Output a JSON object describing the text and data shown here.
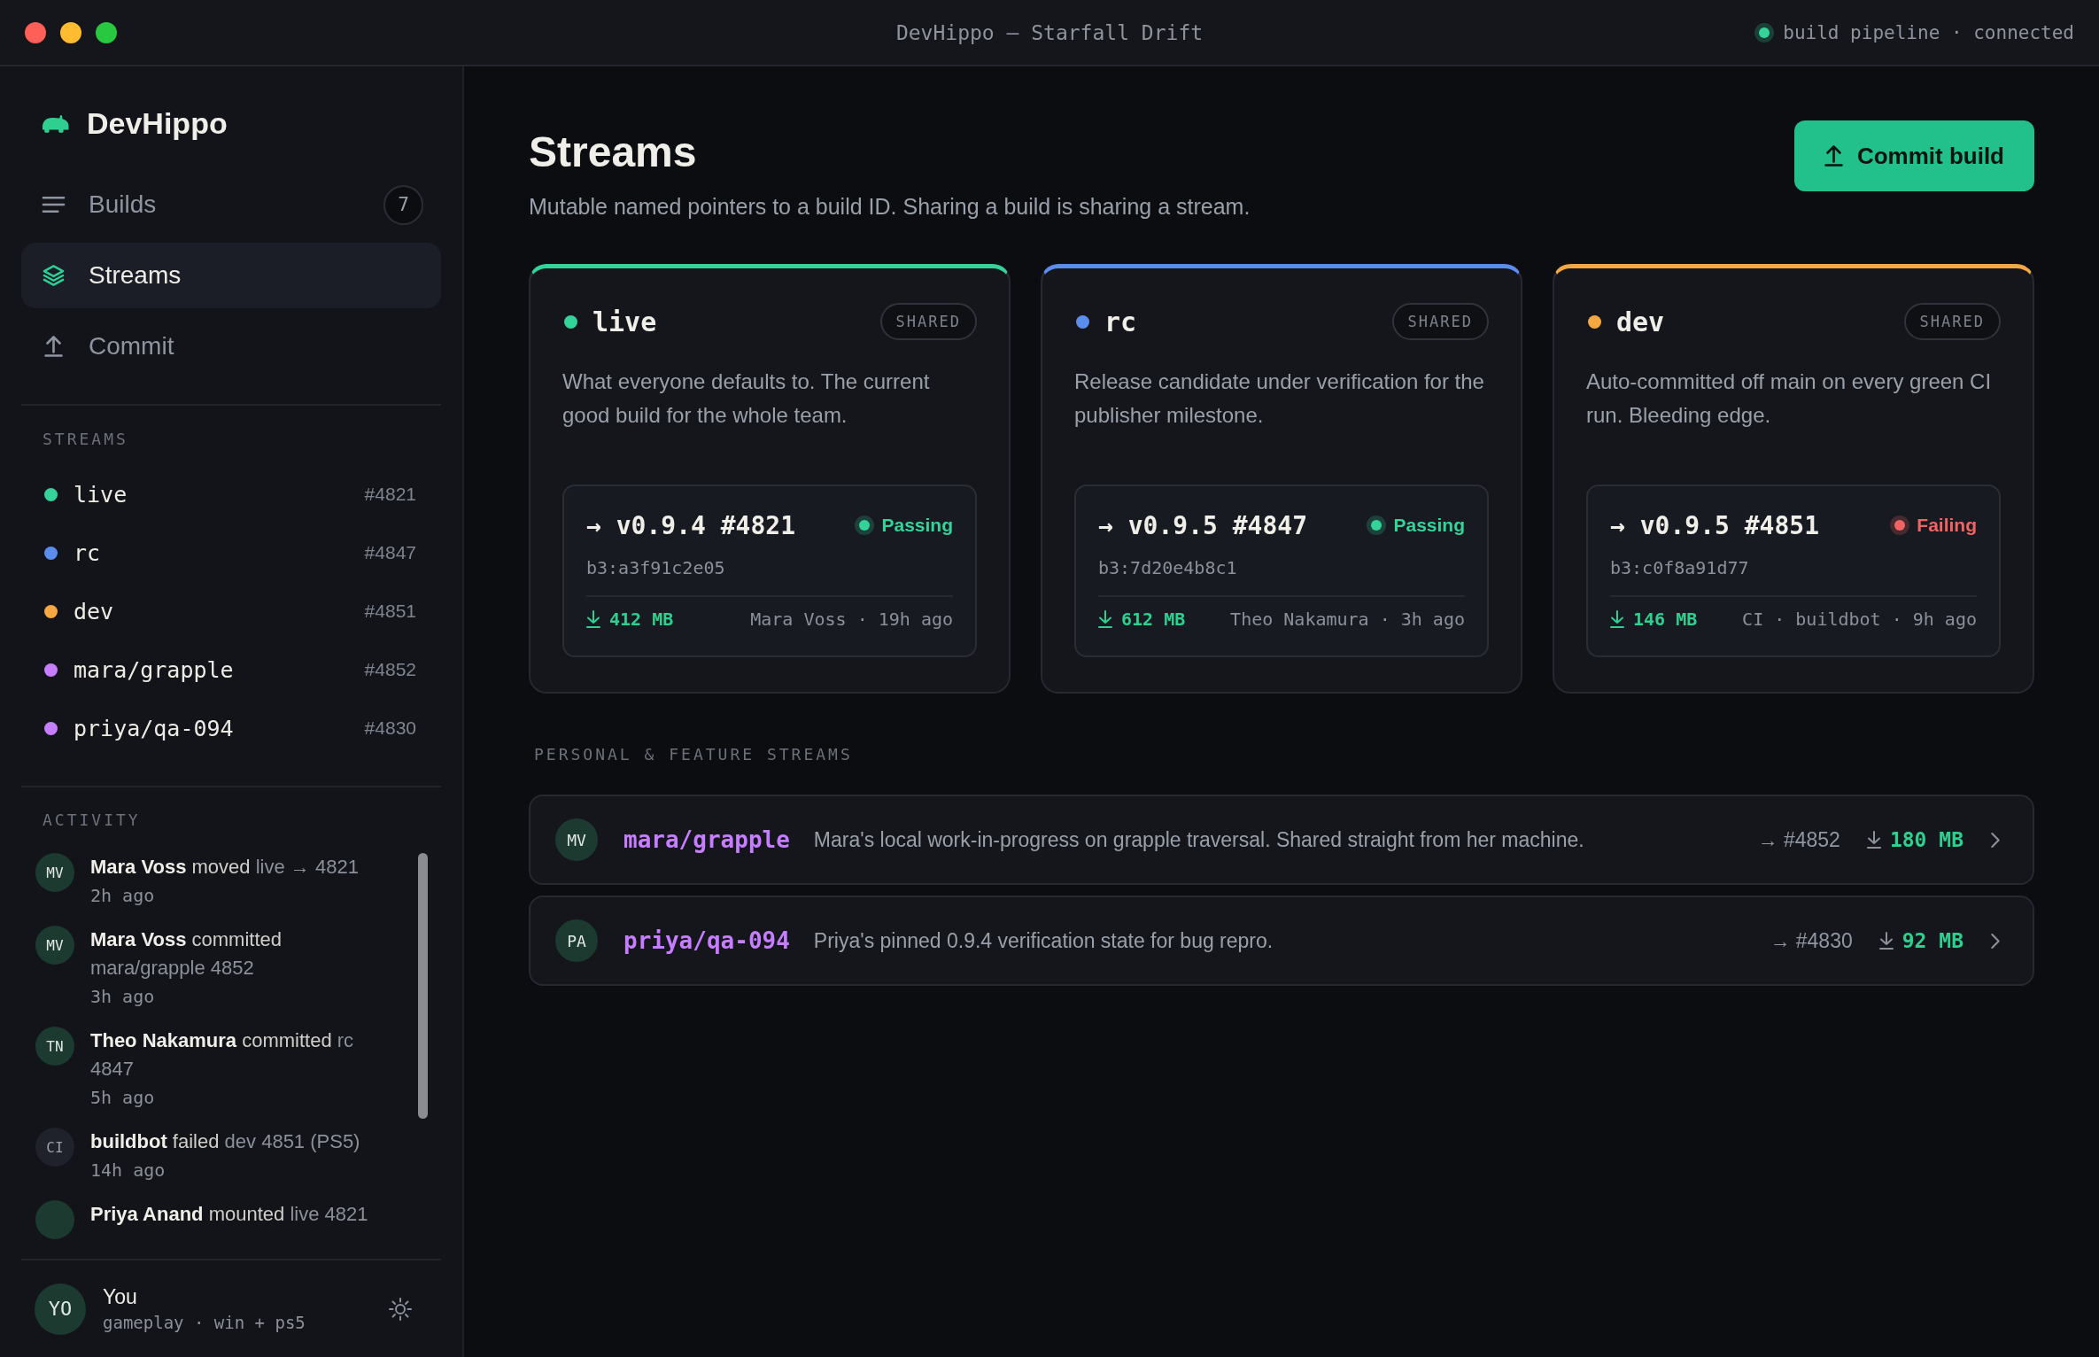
{
  "window": {
    "title": "DevHippo — Starfall Drift",
    "status": {
      "text": "build pipeline · connected",
      "connected": true
    }
  },
  "sidebar": {
    "brand": "DevHippo",
    "nav": [
      {
        "label": "Builds",
        "badge": "7",
        "selected": false
      },
      {
        "label": "Streams",
        "selected": true
      },
      {
        "label": "Commit",
        "selected": false
      }
    ],
    "streams_heading": "STREAMS",
    "streams": [
      {
        "name": "live",
        "build": "#4821",
        "color": "#34d399"
      },
      {
        "name": "rc",
        "build": "#4847",
        "color": "#5b8def"
      },
      {
        "name": "dev",
        "build": "#4851",
        "color": "#f5a742"
      },
      {
        "name": "mara/grapple",
        "build": "#4852",
        "color": "#c77dff"
      },
      {
        "name": "priya/qa-094",
        "build": "#4830",
        "color": "#c77dff"
      }
    ],
    "activity_heading": "ACTIVITY",
    "activity": [
      {
        "kind": "user",
        "initials": "MV",
        "actor": "Mara Voss",
        "action": "moved",
        "target": "live → 4821",
        "time": "2h ago"
      },
      {
        "kind": "user",
        "initials": "MV",
        "actor": "Mara Voss",
        "action": "committed",
        "target": "mara/grapple 4852",
        "time": "3h ago"
      },
      {
        "kind": "user",
        "initials": "TN",
        "actor": "Theo Nakamura",
        "action": "committed",
        "target": "rc 4847",
        "time": "5h ago"
      },
      {
        "kind": "bot",
        "initials": "CI",
        "actor": "buildbot",
        "action": "failed",
        "target": "dev 4851 (PS5)",
        "time": "14h ago"
      },
      {
        "kind": "user",
        "actor": "Priya Anand",
        "action": "mounted",
        "target": "live 4821"
      }
    ],
    "user": {
      "initials": "YO",
      "name": "You",
      "detail": "gameplay · win + ps5"
    }
  },
  "header": {
    "title": "Streams",
    "subtitle": "Mutable named pointers to a build ID. Sharing a build is sharing a stream.",
    "action": "Commit build"
  },
  "shared_streams": [
    {
      "name": "live",
      "color": "#34d399",
      "badge": "SHARED",
      "description": "What everyone defaults to. The current good build for the whole team.",
      "build": {
        "version": "→ v0.9.4 #4821",
        "status": {
          "kind": "passing",
          "label": "Passing"
        },
        "hash": "b3:a3f91c2e05",
        "size": "412 MB",
        "meta": "Mara Voss · 19h ago"
      }
    },
    {
      "name": "rc",
      "color": "#5b8def",
      "badge": "SHARED",
      "description": "Release candidate under verification for the publisher milestone.",
      "build": {
        "version": "→ v0.9.5 #4847",
        "status": {
          "kind": "passing",
          "label": "Passing"
        },
        "hash": "b3:7d20e4b8c1",
        "size": "612 MB",
        "meta": "Theo Nakamura · 3h ago"
      }
    },
    {
      "name": "dev",
      "color": "#f5a742",
      "badge": "SHARED",
      "description": "Auto-committed off main on every green CI run. Bleeding edge.",
      "build": {
        "version": "→ v0.9.5 #4851",
        "status": {
          "kind": "failing",
          "label": "Failing"
        },
        "hash": "b3:c0f8a91d77",
        "size": "146 MB",
        "meta": "CI · buildbot · 9h ago"
      }
    }
  ],
  "personal_heading": "PERSONAL & FEATURE STREAMS",
  "personal_streams": [
    {
      "initials": "MV",
      "name": "mara/grapple",
      "description": "Mara's local work-in-progress on grapple traversal. Shared straight from her machine.",
      "build": "→ #4852",
      "size": "180 MB"
    },
    {
      "initials": "PA",
      "name": "priya/qa-094",
      "description": "Priya's pinned 0.9.4 verification state for bug repro.",
      "build": "→ #4830",
      "size": "92 MB"
    }
  ]
}
